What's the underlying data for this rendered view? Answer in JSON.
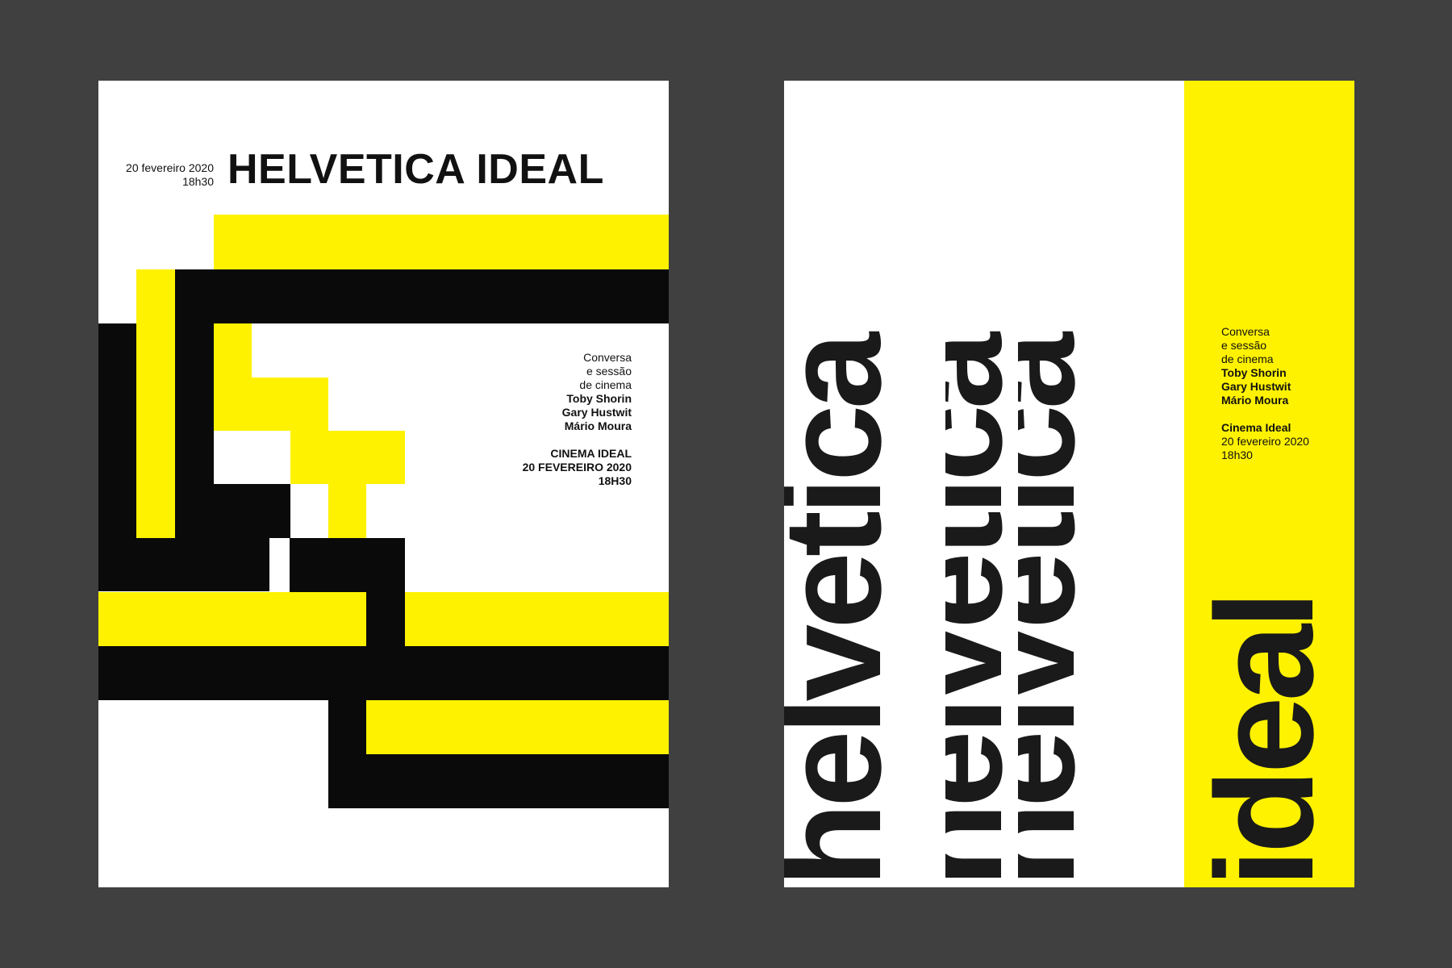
{
  "colors": {
    "background": "#404040",
    "paper": "#ffffff",
    "yellow": "#fff200",
    "black": "#0a0a0a"
  },
  "left_poster": {
    "date_line1": "20 fevereiro 2020",
    "date_line2": "18h30",
    "title": "HELVETICA IDEAL",
    "info": {
      "line1": "Conversa",
      "line2": "e sessão",
      "line3": "de cinema",
      "name1": "Toby Shorin",
      "name2": "Gary Hustwit",
      "name3": "Mário Moura",
      "venue": "CINEMA IDEAL",
      "date": "20 FEVEREIRO 2020",
      "time": "18H30"
    }
  },
  "right_poster": {
    "word_main": "helvetica",
    "word_echo1": "helvetica",
    "word_echo2": "helvetica",
    "word_side": "ideal",
    "info": {
      "line1": "Conversa",
      "line2": "e sessão",
      "line3": "de cinema",
      "name1": "Toby Shorin",
      "name2": "Gary Hustwit",
      "name3": "Mário Moura",
      "venue": "Cinema Ideal",
      "date": "20 fevereiro 2020",
      "time": "18h30"
    }
  }
}
